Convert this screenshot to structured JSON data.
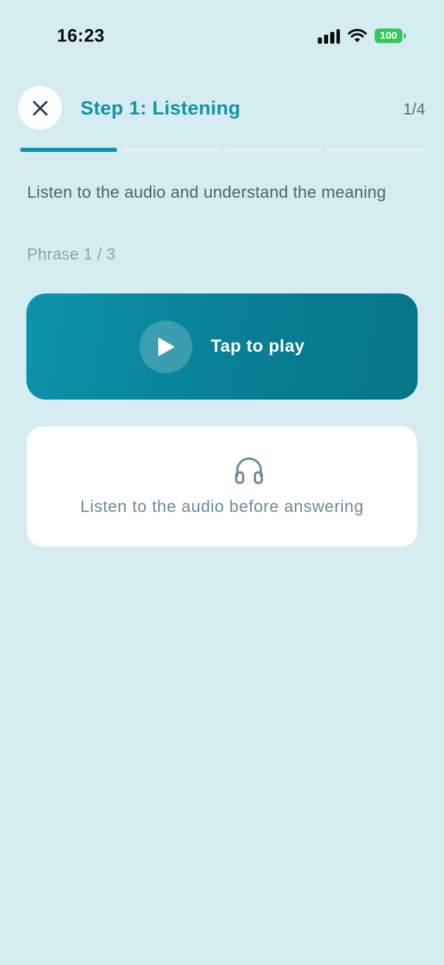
{
  "status_bar": {
    "time": "16:23",
    "battery": "100",
    "battery_color": "#34c759"
  },
  "header": {
    "close_icon": "close-icon",
    "title": "Step 1: Listening",
    "step_counter": "1/4"
  },
  "progress": {
    "total_steps": 4,
    "current_step": 1,
    "active_color": "#1293a9",
    "inactive_color": "#e6f1f4"
  },
  "instruction": "Listen to the audio and understand the meaning",
  "phrase_counter": "Phrase 1 / 3",
  "play_card": {
    "icon": "play-icon",
    "label": "Tap to play",
    "color": "#0a8aa1"
  },
  "hint_card": {
    "icon": "headphones-icon",
    "text": "Listen to the audio before answering"
  },
  "colors": {
    "background": "#d5edf1",
    "accent": "#1293a9"
  }
}
